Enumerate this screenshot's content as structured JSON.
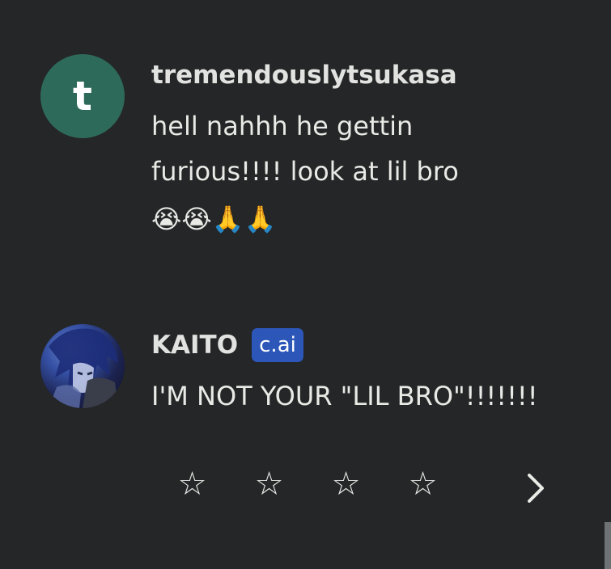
{
  "messages": [
    {
      "avatar_letter": "t",
      "username": "tremendouslytsukasa",
      "text_line1": "hell nahhh he gettin",
      "text_line2": "furious!!!! look at lil bro",
      "emojis": "😭😭🙏🙏"
    },
    {
      "username": "KAITO",
      "badge": "c.ai",
      "text": "I'M NOT YOUR \"LIL BRO\"!!!!!!!"
    }
  ],
  "rating": {
    "filled": 0,
    "max": 4,
    "star_glyph": "☆"
  },
  "colors": {
    "background": "#242627",
    "avatar_teal": "#2e6a5a",
    "badge_blue": "#2c57b8",
    "text": "#e9e9e6"
  }
}
